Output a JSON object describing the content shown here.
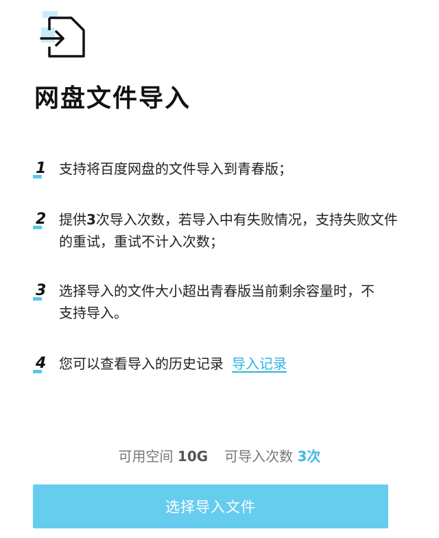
{
  "header": {
    "icon": "file-import-icon",
    "title": "网盘文件导入"
  },
  "rules": [
    {
      "num": "1",
      "text": "支持将百度网盘的文件导入到青春版；"
    },
    {
      "num": "2",
      "text_before": "提供",
      "text_bold": "3",
      "text_after": "次导入次数，若导入中有失败情况，支持失败文件的重试，重试不计入次数；"
    },
    {
      "num": "3",
      "text": "选择导入的文件大小超出青春版当前剩余容量时，不支持导入。"
    },
    {
      "num": "4",
      "text": "您可以查看导入的历史记录",
      "link": "导入记录"
    }
  ],
  "stats": {
    "space_label": "可用空间",
    "space_value": "10G",
    "count_label": "可导入次数",
    "count_value": "3次"
  },
  "action": {
    "button_label": "选择导入文件"
  },
  "colors": {
    "accent": "#5ac8ec",
    "button": "#66cdee",
    "link": "#2fb3e0"
  }
}
